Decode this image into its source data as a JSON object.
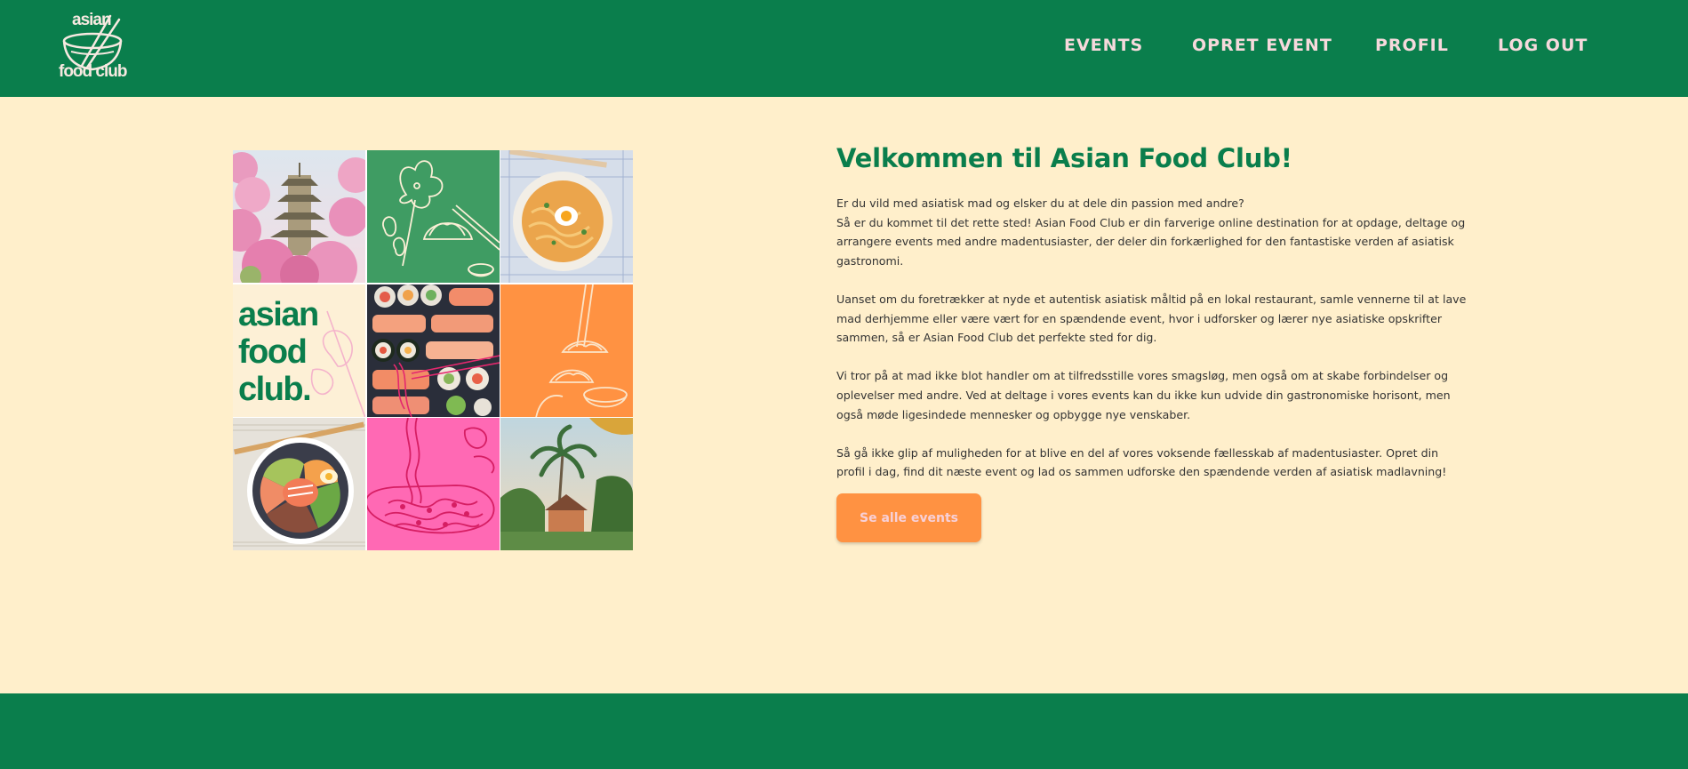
{
  "colors": {
    "brand_green": "#0A7E4C",
    "cream_background": "#FFEFCB",
    "accent_orange": "#FF9242",
    "accent_pink": "#FF69B4",
    "nav_text_pink": "#F6D9DC"
  },
  "logo": {
    "line1": "asian",
    "line2": "food club",
    "icon": "bowl-chopsticks-icon"
  },
  "nav": {
    "items": [
      {
        "label": "EVENTS"
      },
      {
        "label": "OPRET EVENT"
      },
      {
        "label": "PROFIL"
      },
      {
        "label": "LOG OUT"
      }
    ]
  },
  "collage": {
    "brand_tile_text": [
      "asian",
      "food",
      "club."
    ],
    "tiles": [
      "pagoda-cherry-blossom-photo",
      "dumplings-line-art-green",
      "ramen-bowl-photo",
      "asian-food-club-logo",
      "sushi-platter-photo",
      "dumplings-chopsticks-line-art-orange",
      "poke-bowl-photo",
      "noodles-line-art-pink",
      "palm-trees-photo"
    ]
  },
  "main": {
    "title": "Velkommen til Asian Food Club!",
    "paragraph1_line1": "Er du vild med asiatisk mad og elsker du at dele din passion med andre?",
    "paragraph1_line2": "Så er du kommet til det rette sted! Asian Food Club er din farverige online destination for at opdage, deltage og arrangere events med andre madentusiaster, der deler din forkærlighed for den fantastiske verden af asiatisk gastronomi.",
    "paragraph2": "Uanset om du foretrækker at nyde et autentisk asiatisk måltid på en lokal restaurant, samle vennerne til at lave mad derhjemme eller være vært for en spændende event, hvor i udforsker og lærer nye asiatiske opskrifter sammen, så er Asian Food Club det perfekte sted for dig.",
    "paragraph3": "Vi tror på at mad ikke blot handler om at tilfredsstille vores smagsløg, men også om at skabe forbindelser og oplevelser med andre. Ved at deltage i vores events kan du ikke kun udvide din gastronomiske horisont, men også møde ligesindede mennesker og opbygge nye venskaber.",
    "paragraph4": "Så gå ikke glip af muligheden for at blive en del af vores voksende fællesskab af madentusiaster. Opret din profil i dag, find dit næste event og lad os sammen udforske den spændende verden af asiatisk madlavning!",
    "cta_label": "Se alle events"
  }
}
